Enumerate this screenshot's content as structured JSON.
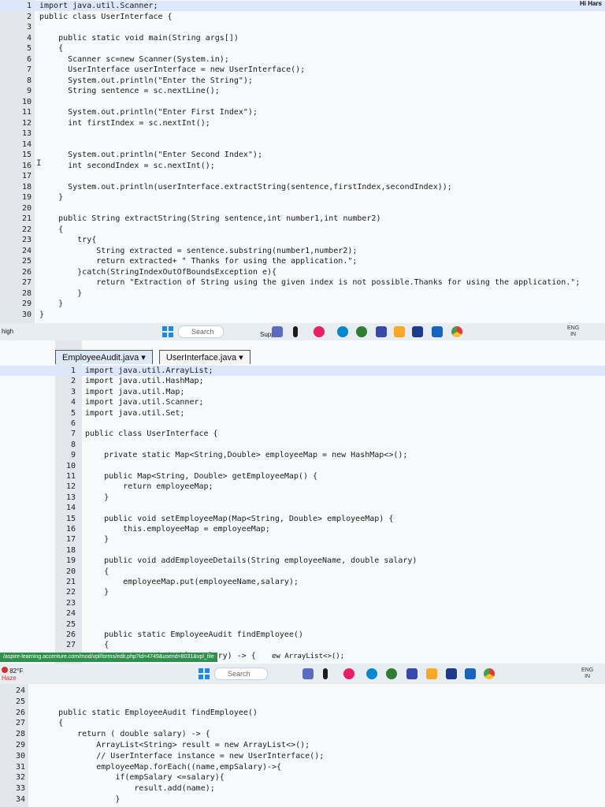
{
  "panel1": {
    "header_right": "Hi Hars",
    "highlight_line": 1,
    "lines": [
      {
        "n": "1",
        "t": "import java.util.Scanner;"
      },
      {
        "n": "2",
        "t": "public class UserInterface {"
      },
      {
        "n": "3",
        "t": ""
      },
      {
        "n": "4",
        "t": "    public static void main(String args[])"
      },
      {
        "n": "5",
        "t": "    {"
      },
      {
        "n": "6",
        "t": "      Scanner sc=new Scanner(System.in);"
      },
      {
        "n": "7",
        "t": "      UserInterface userInterface = new UserInterface();"
      },
      {
        "n": "8",
        "t": "      System.out.println(\"Enter the String\");"
      },
      {
        "n": "9",
        "t": "      String sentence = sc.nextLine();"
      },
      {
        "n": "10",
        "t": ""
      },
      {
        "n": "11",
        "t": "      System.out.println(\"Enter First Index\");"
      },
      {
        "n": "12",
        "t": "      int firstIndex = sc.nextInt();"
      },
      {
        "n": "13",
        "t": ""
      },
      {
        "n": "14",
        "t": ""
      },
      {
        "n": "15",
        "t": "      System.out.println(\"Enter Second Index\");"
      },
      {
        "n": "16",
        "t": "      int secondIndex = sc.nextInt();"
      },
      {
        "n": "17",
        "t": ""
      },
      {
        "n": "18",
        "t": "      System.out.println(userInterface.extractString(sentence,firstIndex,secondIndex));"
      },
      {
        "n": "19",
        "t": "    }"
      },
      {
        "n": "20",
        "t": ""
      },
      {
        "n": "21",
        "t": "    public String extractString(String sentence,int number1,int number2)"
      },
      {
        "n": "22",
        "t": "    {"
      },
      {
        "n": "23",
        "t": "        try{"
      },
      {
        "n": "24",
        "t": "            String extracted = sentence.substring(number1,number2);"
      },
      {
        "n": "25",
        "t": "            return extracted+ \" Thanks for using the application.\";"
      },
      {
        "n": "26",
        "t": "        }catch(StringIndexOutOfBoundsException e){"
      },
      {
        "n": "27",
        "t": "            return \"Extraction of String using the given index is not possible.Thanks for using the application.\";"
      },
      {
        "n": "28",
        "t": "        }"
      },
      {
        "n": "29",
        "t": "    }"
      },
      {
        "n": "30",
        "t": "}"
      }
    ]
  },
  "taskbar1": {
    "left_text": "high",
    "search_placeholder": "Search",
    "support_text": "Support",
    "lang": "ENG",
    "region": "IN"
  },
  "panel2": {
    "header_right": "H",
    "tabs": [
      "EmployeeAudit.java",
      "UserInterface.java"
    ],
    "lines": [
      {
        "n": "1",
        "t": "import java.util.ArrayList;"
      },
      {
        "n": "2",
        "t": "import java.util.HashMap;"
      },
      {
        "n": "3",
        "t": "import java.util.Map;"
      },
      {
        "n": "4",
        "t": "import java.util.Scanner;"
      },
      {
        "n": "5",
        "t": "import java.util.Set;"
      },
      {
        "n": "6",
        "t": ""
      },
      {
        "n": "7",
        "t": "public class UserInterface {"
      },
      {
        "n": "8",
        "t": ""
      },
      {
        "n": "9",
        "t": "    private static Map<String,Double> employeeMap = new HashMap<>();"
      },
      {
        "n": "10",
        "t": ""
      },
      {
        "n": "11",
        "t": "    public Map<String, Double> getEmployeeMap() {"
      },
      {
        "n": "12",
        "t": "        return employeeMap;"
      },
      {
        "n": "13",
        "t": "    }"
      },
      {
        "n": "14",
        "t": ""
      },
      {
        "n": "15",
        "t": "    public void setEmployeeMap(Map<String, Double> employeeMap) {"
      },
      {
        "n": "16",
        "t": "        this.employeeMap = employeeMap;"
      },
      {
        "n": "17",
        "t": "    }"
      },
      {
        "n": "18",
        "t": ""
      },
      {
        "n": "19",
        "t": "    public void addEmployeeDetails(String employeeName, double salary)"
      },
      {
        "n": "20",
        "t": "    {"
      },
      {
        "n": "21",
        "t": "        employeeMap.put(employeeName,salary);"
      },
      {
        "n": "22",
        "t": "    }"
      },
      {
        "n": "23",
        "t": ""
      },
      {
        "n": "24",
        "t": ""
      },
      {
        "n": "25",
        "t": ""
      },
      {
        "n": "26",
        "t": "    public static EmployeeAudit findEmployee()"
      },
      {
        "n": "27",
        "t": "    {"
      },
      {
        "n": "28",
        "t": "        return ( double salary) -> {"
      }
    ],
    "overflow_text": "ew ArrayList<>();"
  },
  "taskbar2": {
    "url": "/aspire-learning.accenture.com/mod/vpl/forms/edit.php?id=4749&userid=8031&vpl_file",
    "weather": "82°F",
    "weather_sub": "Haze",
    "search_placeholder": "Search",
    "lang": "ENG",
    "region": "IN"
  },
  "panel3": {
    "lines": [
      {
        "n": "24",
        "t": ""
      },
      {
        "n": "25",
        "t": ""
      },
      {
        "n": "26",
        "t": "    public static EmployeeAudit findEmployee()"
      },
      {
        "n": "27",
        "t": "    {"
      },
      {
        "n": "28",
        "t": "        return ( double salary) -> {"
      },
      {
        "n": "29",
        "t": "            ArrayList<String> result = new ArrayList<>();"
      },
      {
        "n": "30",
        "t": "            // UserInterface instance = new UserInterface();"
      },
      {
        "n": "31",
        "t": "            employeeMap.forEach((name,empSalary)->{"
      },
      {
        "n": "32",
        "t": "                if(empSalary <=salary){"
      },
      {
        "n": "33",
        "t": "                    result.add(name);"
      },
      {
        "n": "34",
        "t": "                }"
      }
    ]
  },
  "colors": {
    "accent": "#1e88e5",
    "keyword": "#7b1fa2",
    "string": "#2e7d32",
    "gutter": "#e3e6ea"
  }
}
